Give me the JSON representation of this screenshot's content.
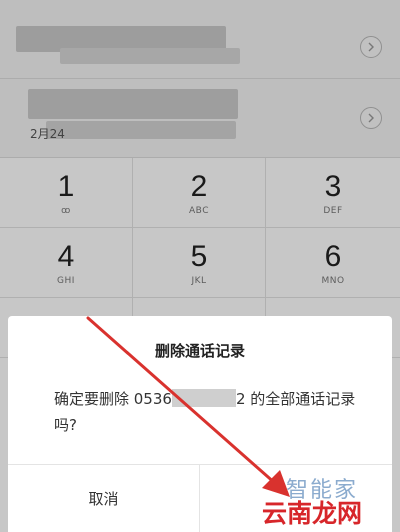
{
  "call_log": {
    "entries": [
      {
        "date_text": ""
      },
      {
        "date_text": "2月24"
      }
    ]
  },
  "dialpad": {
    "keys": [
      {
        "digit": "1",
        "letters": "ꝏ"
      },
      {
        "digit": "2",
        "letters": "ABC"
      },
      {
        "digit": "3",
        "letters": "DEF"
      },
      {
        "digit": "4",
        "letters": "GHI"
      },
      {
        "digit": "5",
        "letters": "JKL"
      },
      {
        "digit": "6",
        "letters": "MNO"
      }
    ]
  },
  "dialog": {
    "title": "删除通话记录",
    "message_prefix": "确定要删除 0536",
    "message_suffix": "2 的全部通话记录",
    "message_line2": "吗?",
    "cancel_label": "取消",
    "confirm_label": ""
  },
  "watermark": {
    "logo_text": "智能家",
    "site_text": "云南龙网"
  },
  "colors": {
    "arrow": "#d9322e",
    "watermark_site": "#d7262a",
    "watermark_logo": "#7fa3c9"
  }
}
